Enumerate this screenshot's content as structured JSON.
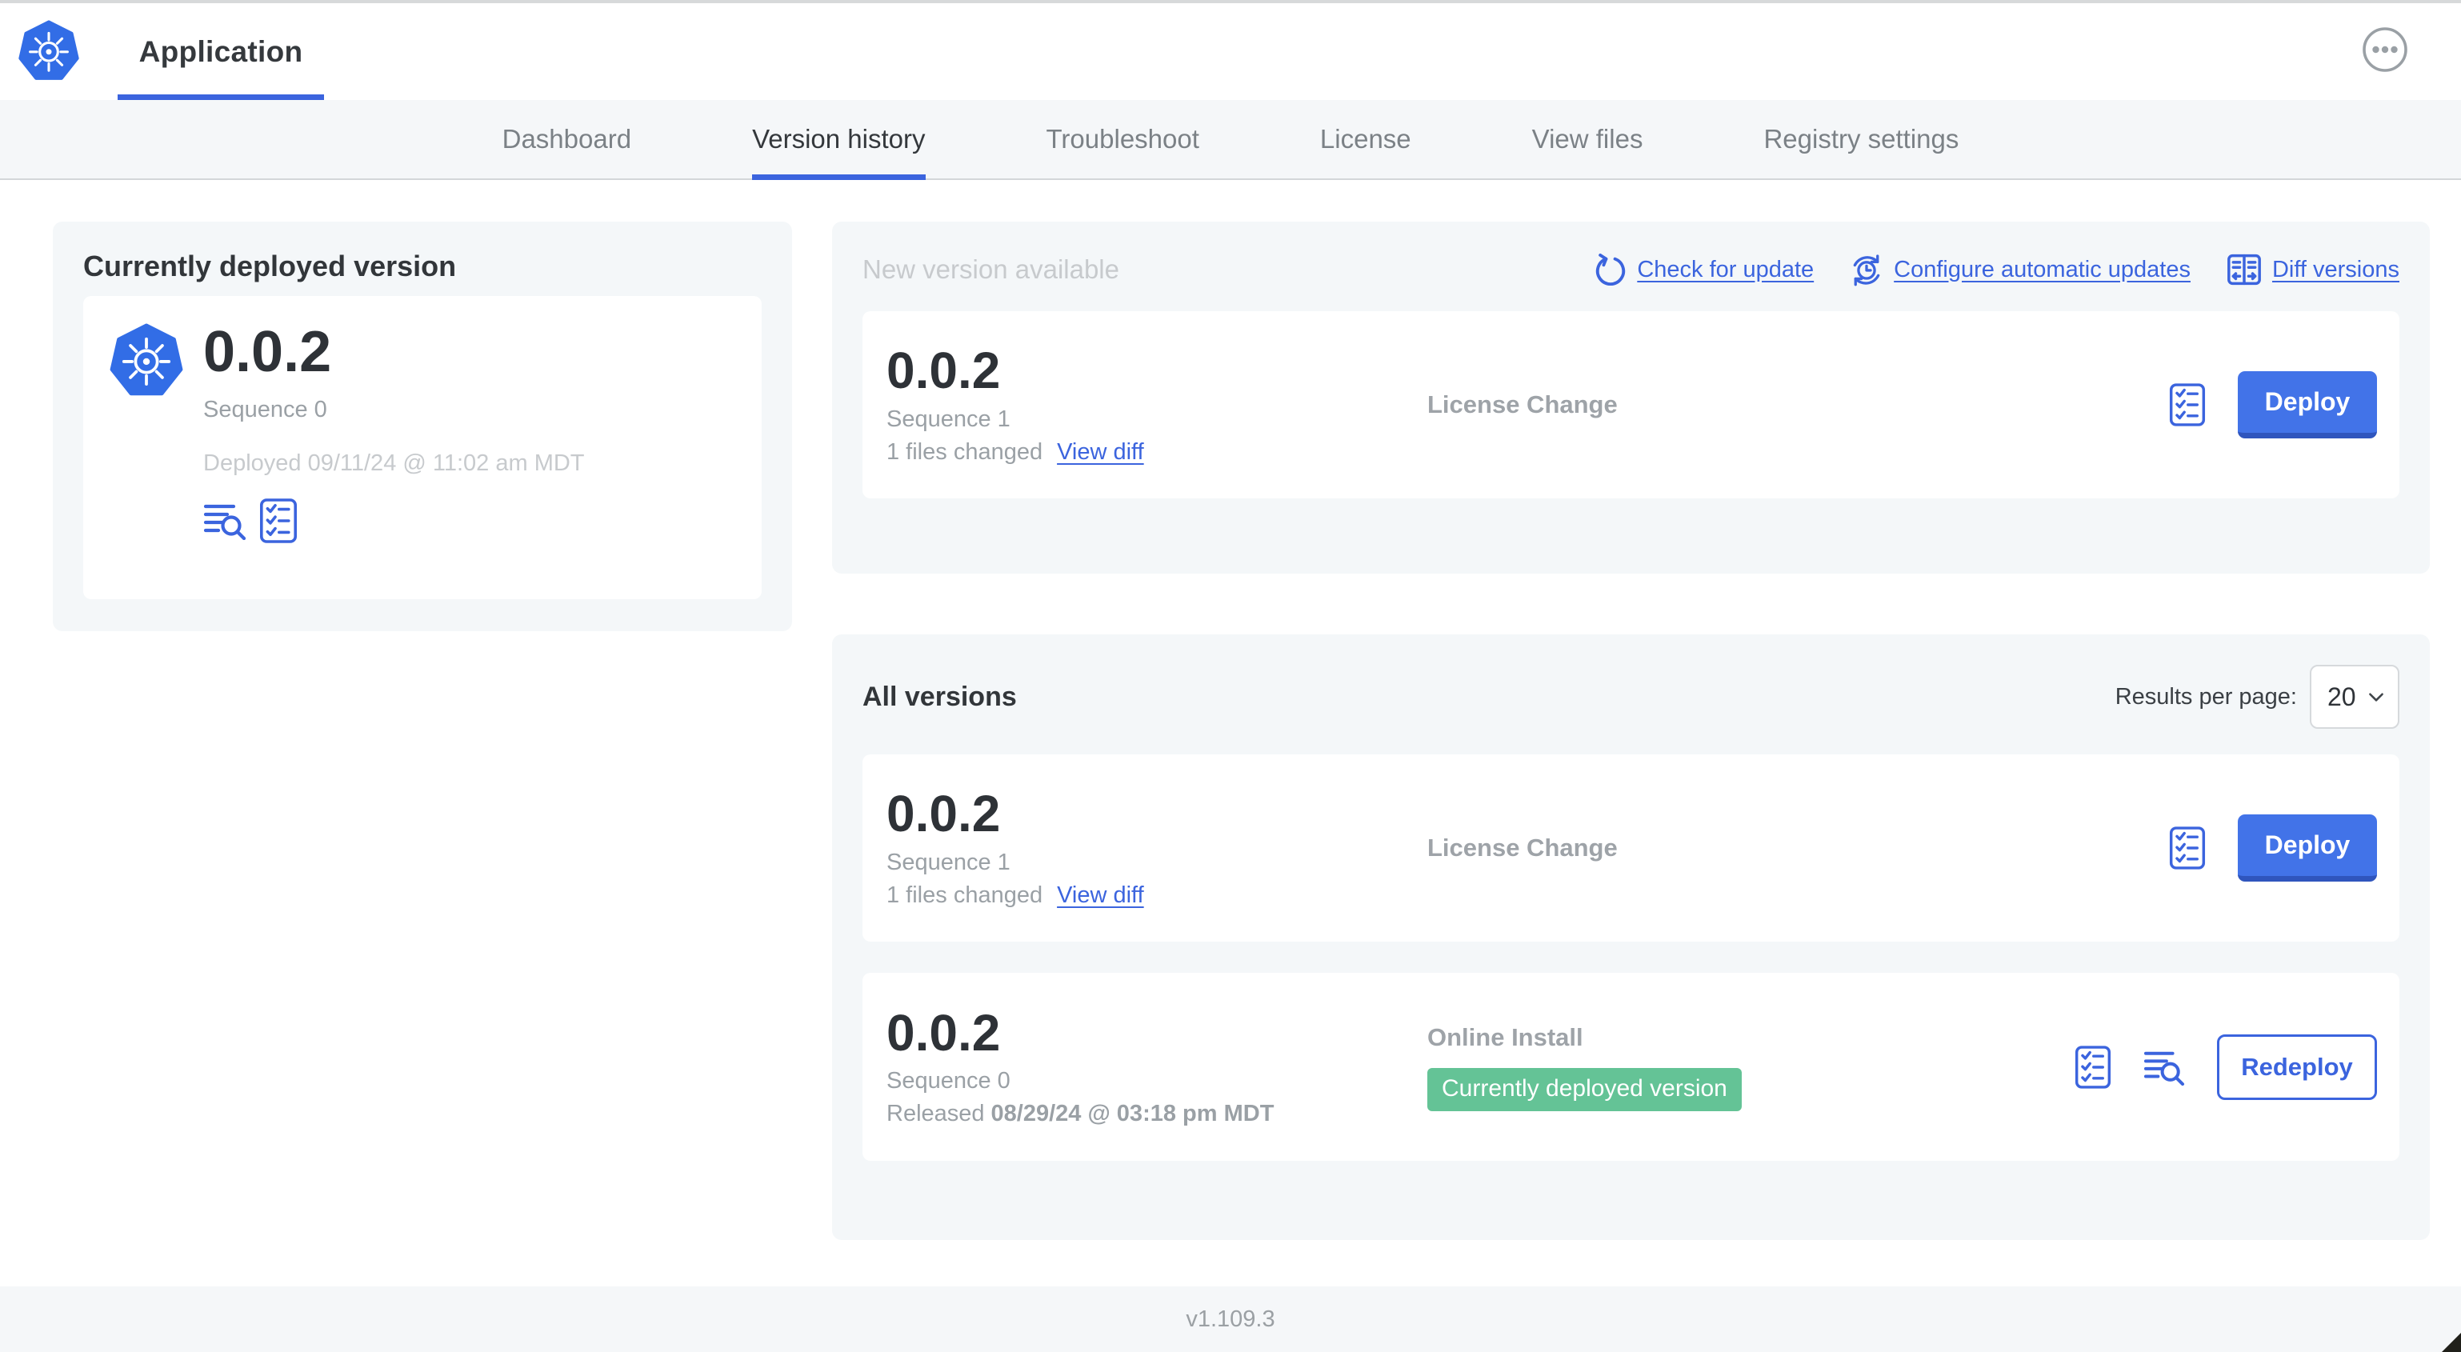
{
  "header": {
    "app_tab_label": "Application"
  },
  "nav": {
    "tabs": [
      "Dashboard",
      "Version history",
      "Troubleshoot",
      "License",
      "View files",
      "Registry settings"
    ],
    "active_tab": "Version history"
  },
  "currently_deployed": {
    "title": "Currently deployed version",
    "version": "0.0.2",
    "sequence": "Sequence 0",
    "deployed_at": "Deployed 09/11/24 @ 11:02 am MDT"
  },
  "new_version": {
    "title": "New version available",
    "check_for_update": "Check for update",
    "configure_automatic_updates": "Configure automatic updates",
    "diff_versions": "Diff versions",
    "card": {
      "version": "0.0.2",
      "sequence": "Sequence 1",
      "files_changed": "1 files changed",
      "view_diff": "View diff",
      "source": "License Change",
      "deploy_label": "Deploy"
    }
  },
  "all_versions": {
    "title": "All versions",
    "results_per_page_label": "Results per page:",
    "results_per_page_value": "20",
    "rows": [
      {
        "version": "0.0.2",
        "sequence": "Sequence 1",
        "files_changed": "1 files changed",
        "view_diff": "View diff",
        "source": "License Change",
        "action_label": "Deploy"
      },
      {
        "version": "0.0.2",
        "sequence": "Sequence 0",
        "released_prefix": "Released",
        "released_at": "08/29/24 @ 03:18 pm MDT",
        "source": "Online Install",
        "badge": "Currently deployed version",
        "action_label": "Redeploy"
      }
    ]
  },
  "footer": {
    "app_manager_version": "v1.109.3"
  },
  "colors": {
    "accent_blue": "#3b64de",
    "kubernetes_blue": "#326de6",
    "primary_button_blue": "#4273e8",
    "badge_green": "#64c396",
    "panel_gray": "#f4f7f9"
  }
}
